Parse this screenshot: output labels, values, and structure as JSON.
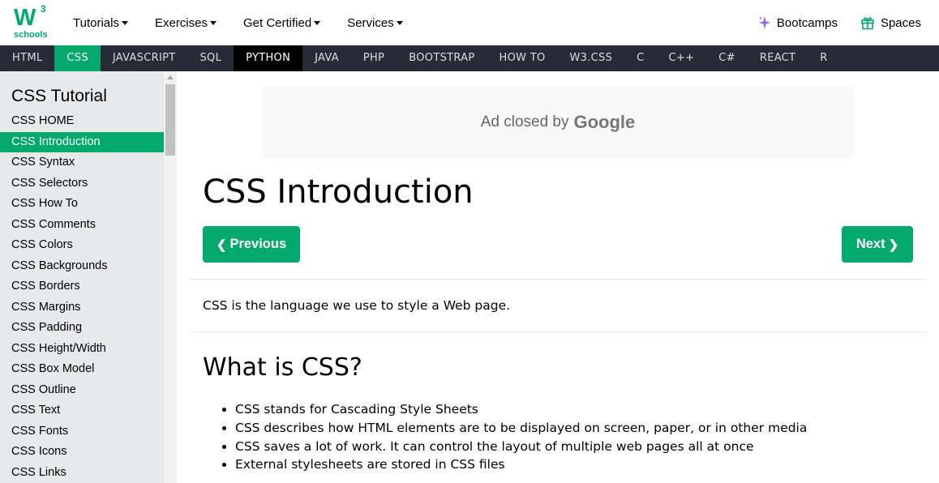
{
  "logo": {
    "mark": "W",
    "superscript": "3",
    "text": "schools"
  },
  "top_nav": [
    {
      "label": "Tutorials"
    },
    {
      "label": "Exercises"
    },
    {
      "label": "Get Certified"
    },
    {
      "label": "Services"
    }
  ],
  "top_right": {
    "bootcamps": "Bootcamps",
    "spaces": "Spaces"
  },
  "lang_bar": [
    "HTML",
    "CSS",
    "JAVASCRIPT",
    "SQL",
    "PYTHON",
    "JAVA",
    "PHP",
    "BOOTSTRAP",
    "HOW TO",
    "W3.CSS",
    "C",
    "C++",
    "C#",
    "REACT",
    "R"
  ],
  "lang_active": "CSS",
  "sidebar": {
    "title": "CSS Tutorial",
    "items": [
      "CSS HOME",
      "CSS Introduction",
      "CSS Syntax",
      "CSS Selectors",
      "CSS How To",
      "CSS Comments",
      "CSS Colors",
      "CSS Backgrounds",
      "CSS Borders",
      "CSS Margins",
      "CSS Padding",
      "CSS Height/Width",
      "CSS Box Model",
      "CSS Outline",
      "CSS Text",
      "CSS Fonts",
      "CSS Icons",
      "CSS Links"
    ],
    "active_index": 1
  },
  "ad": {
    "closed_by": "Ad closed by",
    "brand": "Google"
  },
  "main": {
    "title": "CSS Introduction",
    "prev_label": "Previous",
    "next_label": "Next",
    "intro": "CSS is the language we use to style a Web page.",
    "section_title": "What is CSS?",
    "bullets": [
      "CSS stands for Cascading Style Sheets",
      "CSS describes how HTML elements are to be displayed on screen, paper, or in other media",
      "CSS saves a lot of work. It can control the layout of multiple web pages all at once",
      "External stylesheets are stored in CSS files"
    ]
  },
  "colors": {
    "brand_green": "#04AA6D",
    "lang_bar_bg": "#282A35",
    "sidebar_bg": "#E7E9EB"
  }
}
